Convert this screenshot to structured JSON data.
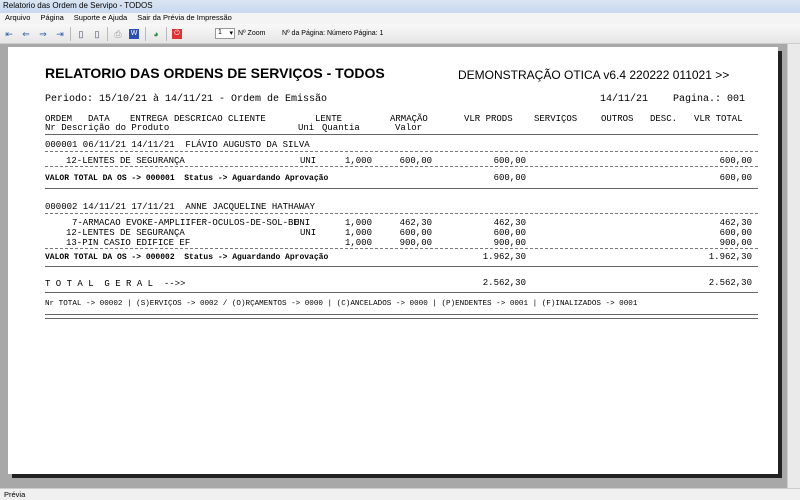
{
  "window": {
    "title": "Relatorio das Ordem de Servipo - TODOS"
  },
  "menu": [
    "Arquivo",
    "Página",
    "Suporte e Ajuda",
    "Sair da Prévia de Impressão"
  ],
  "toolbar": {
    "zoom_value": "1",
    "zoom_label": "Nº Zoom",
    "page_label": "Nº da Página: Número Página: 1"
  },
  "report": {
    "title": "RELATORIO DAS ORDENS DE SERVIÇOS - TODOS",
    "app": "DEMONSTRAÇÃO OTICA v6.4 220222 011021 >>",
    "period": "Periodo: 15/10/21 à 14/11/21 - Ordem de Emissão",
    "date": "14/11/21",
    "page": "Pagina.: 001",
    "header1": {
      "ordem": "ORDEM",
      "data": "DATA",
      "entrega": "ENTREGA",
      "cliente": "DESCRICAO CLIENTE",
      "lente": "LENTE",
      "armacao": "ARMAÇÃO",
      "vlr_prods": "VLR PRODS",
      "servicos": "SERVIÇOS",
      "outros": "OUTROS",
      "desc": "DESC.",
      "vlr_total": "VLR TOTAL"
    },
    "header2": {
      "nr": "Nr Descrição do Produto",
      "uni": "Uni",
      "quantia": "Quantia",
      "valor": "Valor"
    },
    "orders": [
      {
        "head": "000001 06/11/21 14/11/21  FLÁVIO AUGUSTO DA SILVA",
        "items": [
          {
            "desc": "12-LENTES DE SEGURANÇA",
            "uni": "UNI",
            "qty": "1,000",
            "valor": "600,00",
            "prods": "600,00",
            "total": "600,00"
          }
        ],
        "total_label": "VALOR TOTAL DA OS -> 000001  Status -> Aguardando Aprovação",
        "prods": "600,00",
        "total": "600,00"
      },
      {
        "head": "000002 14/11/21 17/11/21  ANNE JACQUELINE HATHAWAY",
        "items": [
          {
            "desc": "7-ARMACAO EVOKE-AMPLIIFER-OCULOS-DE-SOL-BE",
            "uni": "UNI",
            "qty": "1,000",
            "valor": "462,30",
            "prods": "462,30",
            "total": "462,30"
          },
          {
            "desc": "12-LENTES DE SEGURANÇA",
            "uni": "UNI",
            "qty": "1,000",
            "valor": "600,00",
            "prods": "600,00",
            "total": "600,00"
          },
          {
            "desc": "13-PIN CASIO EDIFICE EF",
            "uni": "",
            "qty": "1,000",
            "valor": "900,00",
            "prods": "900,00",
            "total": "900,00"
          }
        ],
        "total_label": "VALOR TOTAL DA OS -> 000002  Status -> Aguardando Aprovação",
        "prods": "1.962,30",
        "total": "1.962,30"
      }
    ],
    "grand_label": "T O T A L  G E R A L  -->>",
    "grand_prods": "2.562,30",
    "grand_total": "2.562,30",
    "summary": "Nr TOTAL -> 00002 | (S)ERVIÇOS -> 0002 / (O)RÇAMENTOS -> 0000 | (C)ANCELADOS -> 0000 | (P)ENDENTES -> 0001 | (F)INALIZADOS -> 0001"
  },
  "status": "Prévia"
}
